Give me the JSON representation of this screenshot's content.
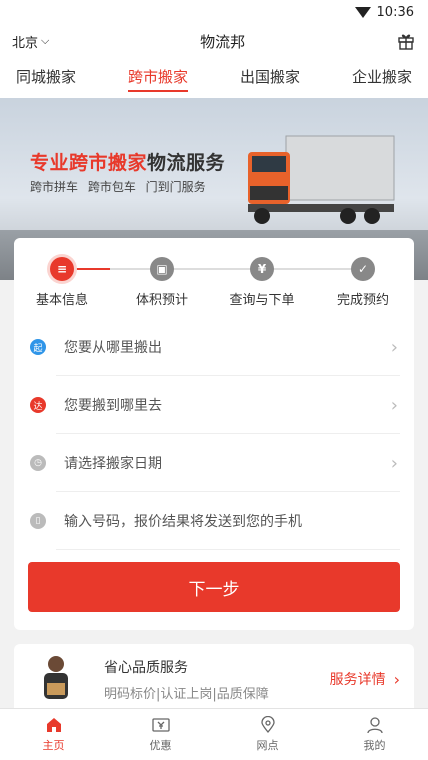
{
  "status_bar": {
    "time": "10:36"
  },
  "header": {
    "city": "北京",
    "title": "物流邦"
  },
  "tabs": [
    {
      "label": "同城搬家",
      "active": false
    },
    {
      "label": "跨市搬家",
      "active": true
    },
    {
      "label": "出国搬家",
      "active": false
    },
    {
      "label": "企业搬家",
      "active": false
    }
  ],
  "banner": {
    "title_highlight": "专业跨市搬家",
    "title_rest": "物流服务",
    "subtitle": "跨市拼车 跨市包车 门到门服务"
  },
  "steps": [
    {
      "label": "基本信息",
      "icon": "list-icon"
    },
    {
      "label": "体积预计",
      "icon": "box-icon"
    },
    {
      "label": "查询与下单",
      "icon": "yen-icon"
    },
    {
      "label": "完成预约",
      "icon": "check-icon"
    }
  ],
  "form": {
    "from": {
      "badge": "起",
      "placeholder": "您要从哪里搬出",
      "color": "#2f95e8"
    },
    "to": {
      "badge": "达",
      "placeholder": "您要搬到哪里去",
      "color": "#e8392b"
    },
    "date": {
      "placeholder": "请选择搬家日期",
      "color": "#bbbbbb"
    },
    "phone": {
      "placeholder": "输入号码，报价结果将发送到您的手机",
      "color": "#bbbbbb"
    },
    "next_label": "下一步"
  },
  "service": {
    "title": "省心品质服务",
    "subtitle": "明码标价|认证上岗|品质保障",
    "link": "服务详情"
  },
  "bottom_nav": [
    {
      "label": "主页",
      "active": true
    },
    {
      "label": "优惠",
      "active": false
    },
    {
      "label": "网点",
      "active": false
    },
    {
      "label": "我的",
      "active": false
    }
  ],
  "colors": {
    "accent": "#e8392b"
  }
}
